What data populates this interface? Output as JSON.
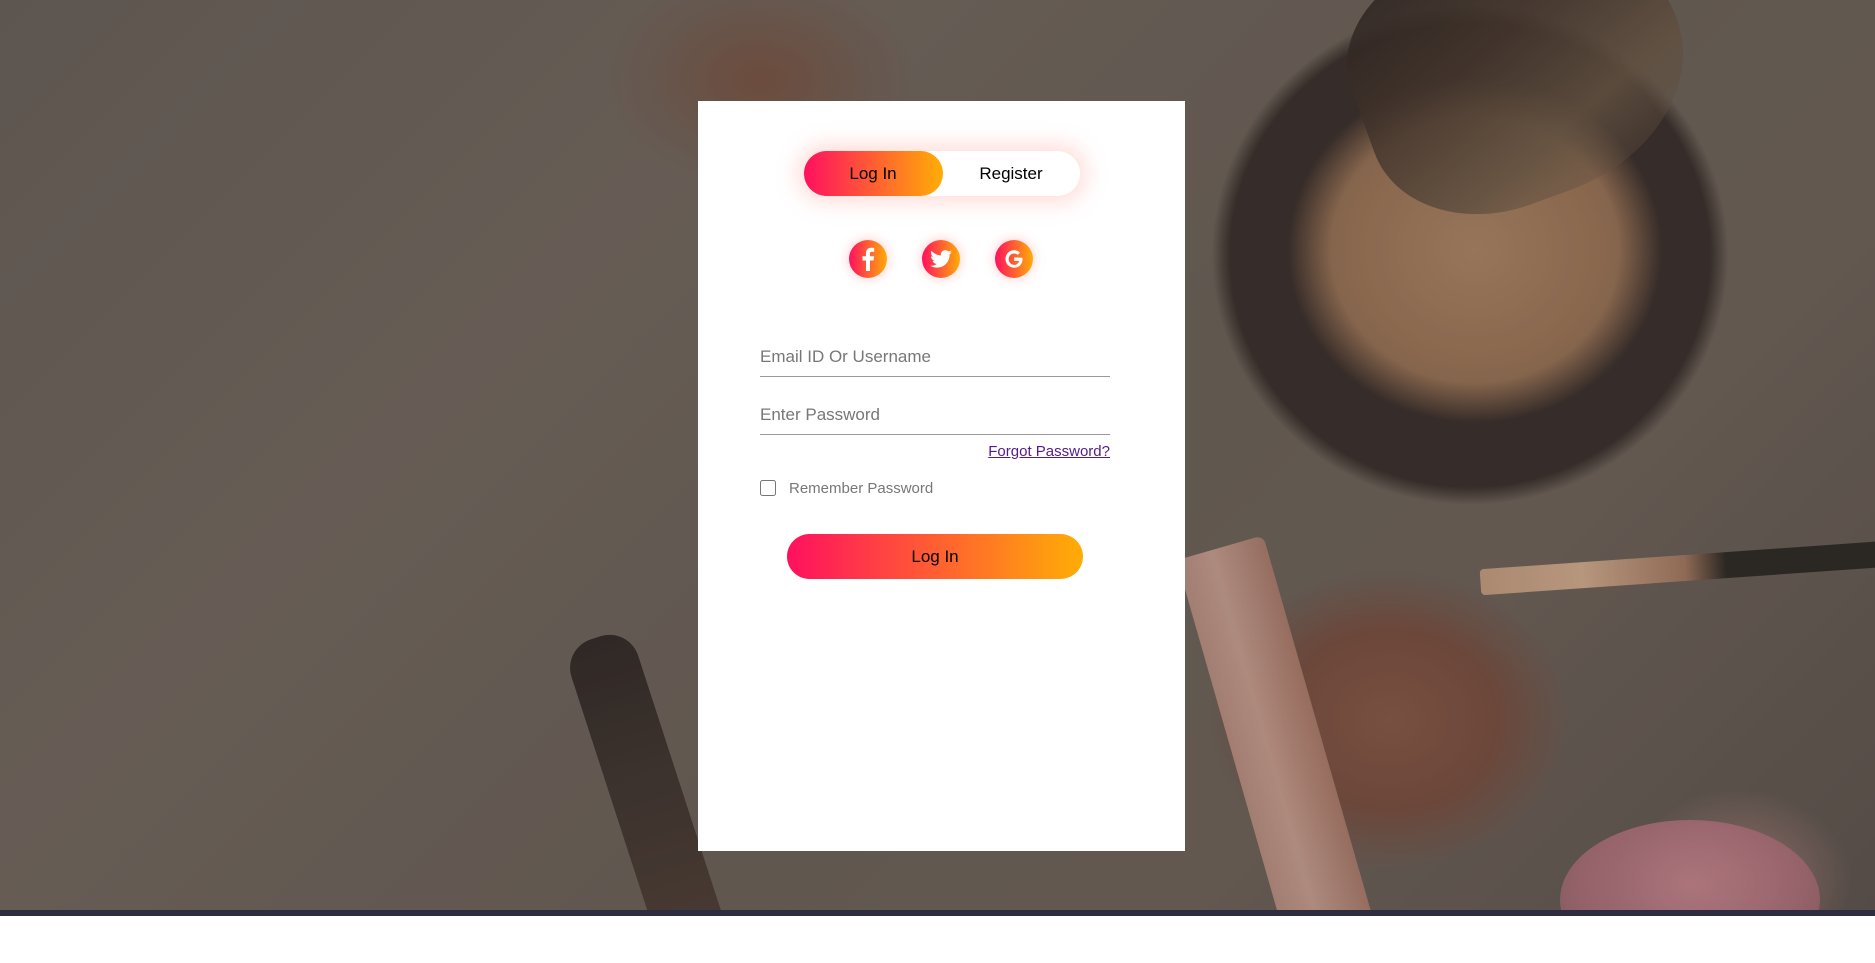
{
  "toggle": {
    "login_label": "Log In",
    "register_label": "Register",
    "active": "login"
  },
  "social": {
    "icons": [
      "facebook-icon",
      "twitter-icon",
      "google-icon"
    ],
    "gradient": [
      "#ff105f",
      "#ffad06"
    ]
  },
  "login_form": {
    "email_placeholder": "Email ID Or Username",
    "email_value": "",
    "password_placeholder": "Enter Password",
    "password_value": "",
    "forgot_password": "Forgot Password?",
    "remember_label": "Remember Password",
    "remember_checked": false,
    "submit_label": "Log In"
  },
  "colors": {
    "accent_start": "#ff105f",
    "accent_end": "#ffad06",
    "link": "#551a8b"
  }
}
